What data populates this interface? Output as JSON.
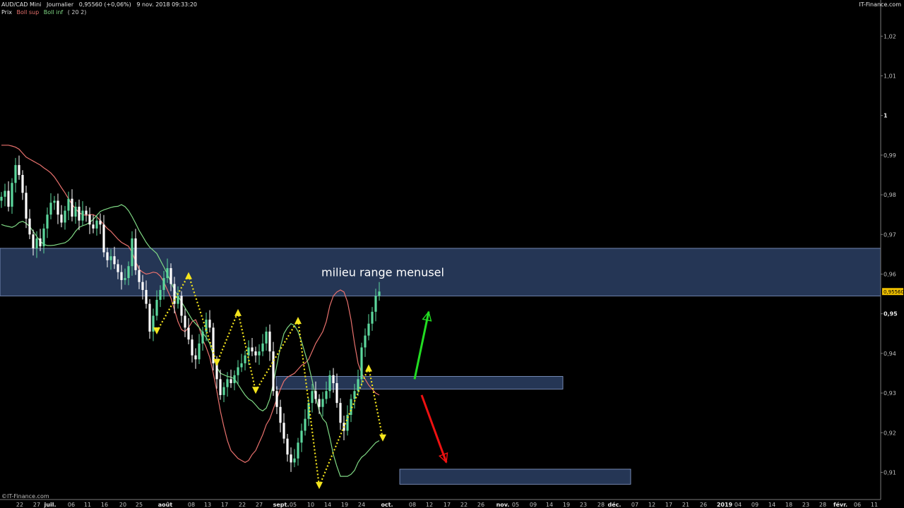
{
  "header": {
    "symbol": "AUD/CAD Mini",
    "period": "Journalier",
    "price_change": "0,95560 (+0,06%)",
    "datetime": "9 nov. 2018 09:33:20",
    "source": "IT-Finance.com",
    "indicators": [
      "Prix",
      "Boll sup",
      "Boll inf",
      "( 20 2)"
    ],
    "copyright": "©IT-Finance.com"
  },
  "colors": {
    "background": "#000000",
    "bull": "#5cd79c",
    "bear": "#ffffff",
    "boll_sup": "#e8716d",
    "boll_inf": "#7fd884",
    "zone_fill": "#2c3f64",
    "zone_stroke": "#8aa0d0",
    "arrow_up": "#22dd22",
    "arrow_down": "#ee1111",
    "pattern": "#f5e51d",
    "last_price_bg": "#f0c000"
  },
  "chart_data": {
    "type": "candlestick",
    "title": "AUD/CAD Mini Journalier",
    "ylim": [
      0.9035,
      1.0245
    ],
    "y_ticks": [
      "1,02",
      "1,01",
      "1",
      "0,99",
      "0,98",
      "0,97",
      "0,96",
      "0,95",
      "0,94",
      "0,93",
      "0,92",
      "0,91"
    ],
    "y_tick_values": [
      1.02,
      1.01,
      1.0,
      0.99,
      0.98,
      0.97,
      0.96,
      0.95,
      0.94,
      0.93,
      0.92,
      0.91
    ],
    "bold_y_ticks": [
      "1",
      "0,95"
    ],
    "last_price": "0,95560",
    "last_price_value": 0.9556,
    "x_ticks": [
      "22",
      "27",
      "juil.",
      "06",
      "11",
      "16",
      "20",
      "25",
      "août",
      "08",
      "13",
      "17",
      "22",
      "27",
      "sept.",
      "05",
      "10",
      "14",
      "19",
      "24",
      "oct.",
      "08",
      "12",
      "17",
      "22",
      "26",
      "nov.",
      "05",
      "09",
      "14",
      "19",
      "23",
      "28",
      "déc.",
      "07",
      "12",
      "17",
      "21",
      "26",
      "2019",
      "04",
      "09",
      "14",
      "18",
      "23",
      "28",
      "févr.",
      "06",
      "11"
    ],
    "bold_x_ticks": [
      "juil.",
      "août",
      "sept.",
      "oct.",
      "nov.",
      "déc.",
      "2019",
      "févr."
    ],
    "closes": [
      0.9795,
      0.981,
      0.977,
      0.983,
      0.9875,
      0.985,
      0.9805,
      0.974,
      0.97,
      0.9665,
      0.969,
      0.967,
      0.9715,
      0.975,
      0.978,
      0.9785,
      0.975,
      0.973,
      0.976,
      0.979,
      0.9745,
      0.977,
      0.9735,
      0.976,
      0.975,
      0.9725,
      0.9715,
      0.9735,
      0.9725,
      0.9655,
      0.9635,
      0.9645,
      0.9625,
      0.9605,
      0.9585,
      0.959,
      0.962,
      0.969,
      0.961,
      0.958,
      0.956,
      0.9525,
      0.9455,
      0.9495,
      0.9535,
      0.956,
      0.959,
      0.9615,
      0.9575,
      0.9525,
      0.9545,
      0.9495,
      0.9465,
      0.9435,
      0.9395,
      0.9385,
      0.9425,
      0.9455,
      0.9485,
      0.9465,
      0.9375,
      0.9335,
      0.9295,
      0.9315,
      0.9335,
      0.9325,
      0.9345,
      0.9365,
      0.9375,
      0.9395,
      0.9415,
      0.9405,
      0.9395,
      0.9405,
      0.9425,
      0.9455,
      0.9405,
      0.9305,
      0.9265,
      0.9225,
      0.9185,
      0.9145,
      0.9125,
      0.9135,
      0.9175,
      0.9205,
      0.9235,
      0.9275,
      0.9305,
      0.9285,
      0.9265,
      0.9285,
      0.9305,
      0.9345,
      0.9325,
      0.9275,
      0.9225,
      0.9205,
      0.9245,
      0.9285,
      0.9305,
      0.9335,
      0.9415,
      0.9445,
      0.9475,
      0.9505,
      0.9545,
      0.9556
    ],
    "series": [
      {
        "name": "Boll sup",
        "values": [
          0.9925,
          0.9925,
          0.9925,
          0.9923,
          0.992,
          0.9915,
          0.9905,
          0.9895,
          0.989,
          0.9885,
          0.988,
          0.9875,
          0.9868,
          0.9862,
          0.9855,
          0.9845,
          0.9832,
          0.9818,
          0.9805,
          0.979,
          0.9776,
          0.9765,
          0.9755,
          0.975,
          0.9748,
          0.975,
          0.975,
          0.9745,
          0.9735,
          0.9725,
          0.9715,
          0.9708,
          0.9698,
          0.9688,
          0.968,
          0.9675,
          0.967,
          0.9655,
          0.9632,
          0.9612,
          0.9605,
          0.96,
          0.9602,
          0.9605,
          0.9603,
          0.9595,
          0.958,
          0.956,
          0.954,
          0.951,
          0.948,
          0.946,
          0.9455,
          0.9465,
          0.948,
          0.9485,
          0.9465,
          0.9435,
          0.9415,
          0.939,
          0.935,
          0.9305,
          0.9255,
          0.9215,
          0.918,
          0.9155,
          0.9145,
          0.9135,
          0.913,
          0.9125,
          0.913,
          0.9145,
          0.9155,
          0.9175,
          0.9195,
          0.922,
          0.9235,
          0.926,
          0.9285,
          0.931,
          0.933,
          0.934,
          0.9345,
          0.935,
          0.936,
          0.937,
          0.9375,
          0.9385,
          0.9405,
          0.9425,
          0.944,
          0.9455,
          0.948,
          0.952,
          0.9545,
          0.9555,
          0.956,
          0.9555,
          0.953,
          0.9485,
          0.9425,
          0.9375,
          0.935,
          0.9335,
          0.932,
          0.931,
          0.93,
          0.9295
        ]
      },
      {
        "name": "Boll inf",
        "values": [
          0.9725,
          0.9722,
          0.972,
          0.9718,
          0.9722,
          0.973,
          0.9733,
          0.9728,
          0.972,
          0.9708,
          0.9695,
          0.9683,
          0.9675,
          0.9672,
          0.9672,
          0.9673,
          0.9675,
          0.9677,
          0.9679,
          0.9685,
          0.9695,
          0.9708,
          0.9718,
          0.9722,
          0.9725,
          0.973,
          0.9738,
          0.9748,
          0.9758,
          0.9762,
          0.9765,
          0.9768,
          0.977,
          0.9771,
          0.9775,
          0.977,
          0.976,
          0.9745,
          0.9728,
          0.971,
          0.9695,
          0.968,
          0.9668,
          0.966,
          0.9652,
          0.9635,
          0.9618,
          0.96,
          0.958,
          0.956,
          0.9545,
          0.953,
          0.9515,
          0.95,
          0.9485,
          0.9475,
          0.9465,
          0.9452,
          0.944,
          0.9425,
          0.9395,
          0.9365,
          0.935,
          0.9346,
          0.9342,
          0.934,
          0.9336,
          0.9322,
          0.9308,
          0.9295,
          0.9285,
          0.928,
          0.927,
          0.926,
          0.9255,
          0.9262,
          0.9285,
          0.9325,
          0.937,
          0.9415,
          0.945,
          0.9465,
          0.9475,
          0.947,
          0.9455,
          0.943,
          0.94,
          0.937,
          0.9332,
          0.929,
          0.9255,
          0.9235,
          0.9225,
          0.9188,
          0.9145,
          0.9115,
          0.909,
          0.909,
          0.909,
          0.9095,
          0.9105,
          0.9125,
          0.9138,
          0.9145,
          0.9155,
          0.9165,
          0.9175,
          0.918
        ]
      }
    ],
    "zones": [
      {
        "label": "milieu range menusel",
        "y_top": 0.9665,
        "y_bottom": 0.9545
      },
      {
        "label": "",
        "y_top": 0.9342,
        "y_bottom": 0.931
      },
      {
        "label": "",
        "y_top": 0.9108,
        "y_bottom": 0.907
      }
    ],
    "pattern_points": [
      [
        44,
        0.9455
      ],
      [
        53,
        0.9598
      ],
      [
        61,
        0.9375
      ],
      [
        67,
        0.9505
      ],
      [
        72,
        0.9305
      ],
      [
        84,
        0.9485
      ],
      [
        90,
        0.9065
      ],
      [
        104,
        0.9365
      ],
      [
        108,
        0.9185
      ]
    ],
    "annotation_arrows": [
      {
        "direction": "up",
        "from": [
          117,
          0.9335
        ],
        "to": [
          121,
          0.9505
        ]
      },
      {
        "direction": "down",
        "from": [
          119,
          0.9295
        ],
        "to": [
          126,
          0.9125
        ]
      }
    ]
  }
}
